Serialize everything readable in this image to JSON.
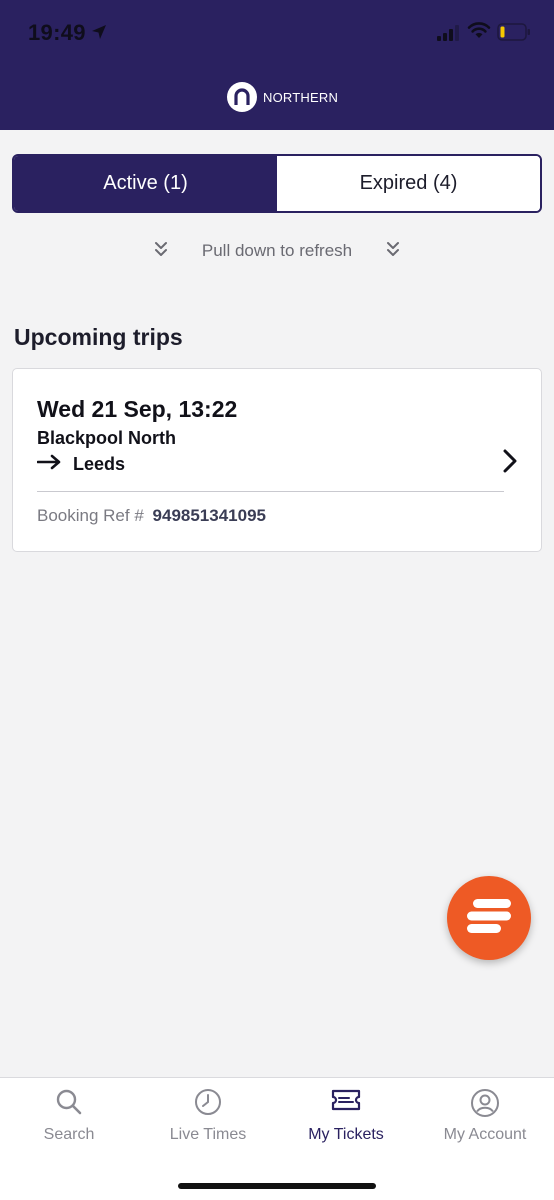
{
  "status_bar": {
    "time": "19:49"
  },
  "brand": {
    "name": "NORTHERN"
  },
  "tabs_segment": {
    "active_label": "Active (1)",
    "expired_label": "Expired (4)"
  },
  "refresh": {
    "text": "Pull down to refresh"
  },
  "upcoming": {
    "title": "Upcoming trips",
    "trips": [
      {
        "datetime": "Wed 21 Sep, 13:22",
        "origin": "Blackpool North",
        "destination": "Leeds",
        "booking_label": "Booking Ref #",
        "booking_ref": "949851341095"
      }
    ]
  },
  "fab": {
    "icon": "chat-icon"
  },
  "tabbar": {
    "items": [
      {
        "label": "Search",
        "icon": "search-icon"
      },
      {
        "label": "Live Times",
        "icon": "clock-icon"
      },
      {
        "label": "My Tickets",
        "icon": "ticket-icon",
        "selected": true
      },
      {
        "label": "My Account",
        "icon": "account-icon"
      }
    ]
  },
  "colors": {
    "header": "#2a2160",
    "accent": "#ee5a25",
    "background": "#f3f3f4"
  }
}
